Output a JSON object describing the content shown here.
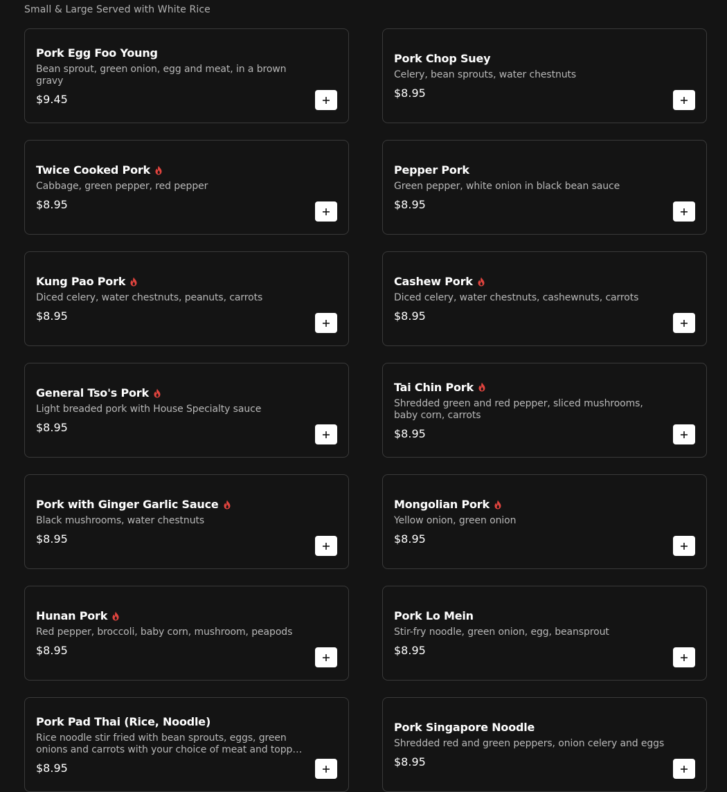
{
  "section": {
    "subtitle": "Small & Large Served with White Rice"
  },
  "colors": {
    "background": "#141414",
    "spicy": "#e0443e",
    "button": "#ffffff"
  },
  "items": [
    {
      "name": "Pork Egg Foo Young",
      "spicy": false,
      "description": "Bean sprout, green onion, egg and meat, in a brown gravy",
      "price": "$9.45"
    },
    {
      "name": "Pork Chop Suey",
      "spicy": false,
      "description": "Celery, bean sprouts, water chestnuts",
      "price": "$8.95"
    },
    {
      "name": "Twice Cooked Pork",
      "spicy": true,
      "description": "Cabbage, green pepper, red pepper",
      "price": "$8.95"
    },
    {
      "name": "Pepper Pork",
      "spicy": false,
      "description": "Green pepper, white onion in black bean sauce",
      "price": "$8.95"
    },
    {
      "name": "Kung Pao Pork",
      "spicy": true,
      "description": "Diced celery, water chestnuts, peanuts, carrots",
      "price": "$8.95"
    },
    {
      "name": "Cashew Pork",
      "spicy": true,
      "description": "Diced celery, water chestnuts, cashewnuts, carrots",
      "price": "$8.95"
    },
    {
      "name": "General Tso's Pork",
      "spicy": true,
      "description": "Light breaded pork with House Specialty sauce",
      "price": "$8.95"
    },
    {
      "name": "Tai Chin Pork",
      "spicy": true,
      "description": "Shredded green and red pepper, sliced mushrooms, baby corn, carrots",
      "price": "$8.95"
    },
    {
      "name": "Pork with Ginger Garlic Sauce",
      "spicy": true,
      "description": "Black mushrooms, water chestnuts",
      "price": "$8.95"
    },
    {
      "name": "Mongolian Pork",
      "spicy": true,
      "description": "Yellow onion, green onion",
      "price": "$8.95"
    },
    {
      "name": "Hunan Pork",
      "spicy": true,
      "description": "Red pepper, broccoli, baby corn, mushroom, peapods",
      "price": "$8.95"
    },
    {
      "name": "Pork Lo Mein",
      "spicy": false,
      "description": "Stir-fry noodle, green onion, egg, beansprout",
      "price": "$8.95"
    },
    {
      "name": "Pork Pad Thai (Rice, Noodle)",
      "spicy": false,
      "description": "Rice noodle stir fried with bean sprouts, eggs, green onions and carrots with your choice of meat and topped with...",
      "price": "$8.95"
    },
    {
      "name": "Pork Singapore Noodle",
      "spicy": false,
      "description": "Shredded red and green peppers, onion celery and eggs",
      "price": "$8.95"
    }
  ]
}
